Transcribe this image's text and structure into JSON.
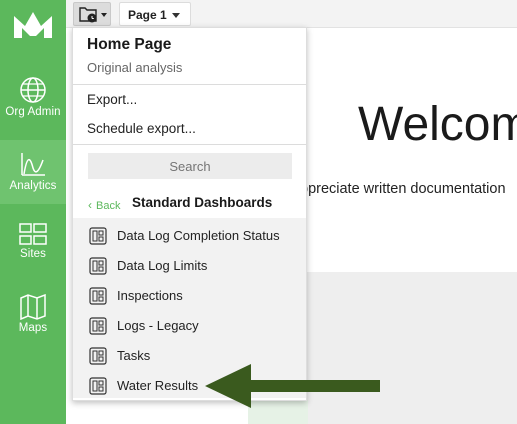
{
  "sidebar": {
    "items": [
      {
        "label": "Org Admin",
        "icon": "globe-icon",
        "active": false
      },
      {
        "label": "Analytics",
        "icon": "chart-icon",
        "active": true
      },
      {
        "label": "Sites",
        "icon": "sites-grid-icon",
        "active": false
      },
      {
        "label": "Maps",
        "icon": "map-icon",
        "active": false
      }
    ],
    "color": "#5cb85c"
  },
  "topbar": {
    "folder_icon": "folder-clock-icon",
    "page_selector": "Page 1"
  },
  "main": {
    "welcome": "Welcom",
    "subtext": "ppreciate written documentation"
  },
  "menu": {
    "title": "Home Page",
    "subtitle": "Original analysis",
    "export": "Export...",
    "schedule_export": "Schedule export...",
    "search_placeholder": "Search",
    "back_label": "Back",
    "breadcrumb": "Standard Dashboards",
    "dashboards": [
      "Data Log Completion Status",
      "Data Log Limits",
      "Inspections",
      "Logs - Legacy",
      "Tasks",
      "Water Results"
    ]
  },
  "annotation": {
    "type": "arrow",
    "color": "#3a5a1e",
    "points_to": "Water Results"
  }
}
